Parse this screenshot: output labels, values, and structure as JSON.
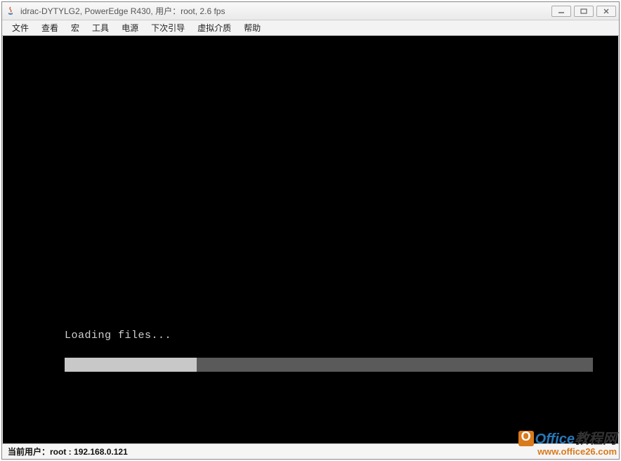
{
  "window": {
    "title": "idrac-DYTYLG2, PowerEdge R430, 用户：root, 2.6 fps"
  },
  "menu": {
    "items": [
      "文件",
      "查看",
      "宏",
      "工具",
      "电源",
      "下次引导",
      "虚拟介质",
      "帮助"
    ]
  },
  "console": {
    "loading_text": "Loading files...",
    "progress_percent": 25
  },
  "statusbar": {
    "label": "当前用户：",
    "user": "root",
    "ip": "192.168.0.121"
  },
  "watermark": {
    "brand_en": "Office",
    "brand_cn": "教程网",
    "url": "www.office26.com"
  }
}
